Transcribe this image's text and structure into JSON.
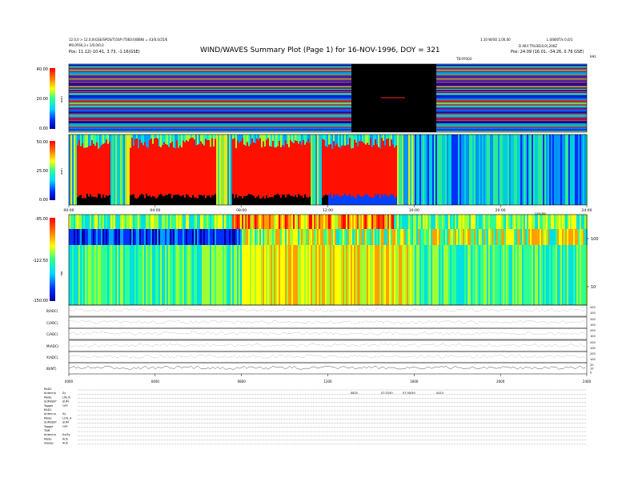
{
  "header": {
    "title": "WIND/WAVES Summary Plot (Page 1) for 16-NOV-1996, DOY = 321",
    "left_line1": "12.0,0 > 12.0,0(GSE/SPOS/T)5SP (T0E0:0(BBN) = 43/0,0/25/E",
    "left_line2": "M0,0F60,3 s 1/0,0/0,0",
    "left_pos": "Pos:    11.12(-10.41, 3.73, -1.16)GSE)",
    "right_line1": "1.10 W/SO 2,00,00",
    "right_line2": "L.0/800T/s 0,0/1",
    "right_line3": "D AILY TRU3E(0,0),200Z",
    "right_pos": "Pos:    24.09 (16.01, -34.26, 0.76 GSE)",
    "top_axis_mid": "T8:0Y0G0",
    "top_axis_right": "kHz"
  },
  "colorbars": {
    "rad2": {
      "label": "RAD2",
      "ticks": [
        "40.00",
        "20.00",
        "0.00"
      ]
    },
    "rad1": {
      "label": "RAD1",
      "ticks": [
        "50.00",
        "25.00",
        "0.00"
      ]
    },
    "tnr": {
      "label": "TNR",
      "ticks": [
        "-95.00",
        "-122.50",
        "-150.00"
      ]
    }
  },
  "time_axis_top": {
    "ticks": [
      "00:00",
      "04:00",
      "08:00",
      "12:00",
      "16:00",
      "20:00",
      "24:00"
    ],
    "label": "GSV(80)"
  },
  "time_axis_bottom": {
    "ticks": [
      "0000",
      "0400",
      "0800",
      "1200",
      "1600",
      "2000",
      "2400"
    ]
  },
  "tnr_freq_axis": {
    "ticks": [
      "100",
      "10"
    ]
  },
  "line_panels": [
    {
      "label": "B(ADC)",
      "ticks": [
        "200",
        "100"
      ]
    },
    {
      "label": "C(ADC)",
      "ticks": [
        "200",
        "100"
      ]
    },
    {
      "label": "C(ADC)",
      "ticks": [
        "200",
        "100"
      ]
    },
    {
      "label": "M(ADC)",
      "ticks": [
        "200",
        "100"
      ]
    },
    {
      "label": "X(ADC)",
      "ticks": [
        "200",
        "100"
      ]
    },
    {
      "label": "IB(NT)",
      "ticks": [
        "20",
        "10",
        "0"
      ]
    }
  ],
  "footer": {
    "rows": [
      {
        "label": "RAD2",
        "value": ""
      },
      {
        "label": "Antenna",
        "value": "Sy"
      },
      {
        "label": "Mode",
        "value": "LIN_R"
      },
      {
        "label": "SUM/SEP",
        "value": "SUM"
      },
      {
        "label": "Toggle",
        "value": "OFF"
      },
      {
        "label": "RAD1",
        "value": ""
      },
      {
        "label": "Antenna",
        "value": "Sy"
      },
      {
        "label": "Mode",
        "value": "LOG_A"
      },
      {
        "label": "SUM/SEP",
        "value": "SUM"
      },
      {
        "label": "Toggle",
        "value": "OFF"
      },
      {
        "label": "TNR",
        "value": ""
      },
      {
        "label": "Antenna",
        "value": "Ex/Ey"
      },
      {
        "label": "Mode",
        "value": "ACE"
      },
      {
        "label": "Sweep",
        "value": "ACE"
      }
    ],
    "row1_annotations": [
      "0820",
      "07:3150",
      "07:30/50",
      "0410"
    ]
  },
  "colors": {
    "spectrogram_low": "#0000a0",
    "spectrogram_mid": "#00e0e0",
    "spectrogram_high": "#ff0000",
    "data_gap": "#000000"
  },
  "chart_data": {
    "type": "heatmap",
    "title": "WIND/WAVES Summary Plot (Page 1) for 16-NOV-1996, DOY = 321",
    "x_range_hours": [
      0,
      24
    ],
    "panels": [
      {
        "name": "RAD2",
        "zrange": [
          0,
          40
        ]
      },
      {
        "name": "RAD1",
        "zrange": [
          0,
          50
        ]
      },
      {
        "name": "TNR",
        "zrange": [
          -150,
          -95
        ]
      }
    ],
    "rad1_intense_hours": [
      {
        "start": 0.3,
        "end": 1.9
      },
      {
        "start": 2.8,
        "end": 6.8
      },
      {
        "start": 7.5,
        "end": 11.2
      },
      {
        "start": 11.7,
        "end": 15.2
      }
    ],
    "rad2_data_gap_hours": [
      13.1,
      17.1
    ]
  }
}
